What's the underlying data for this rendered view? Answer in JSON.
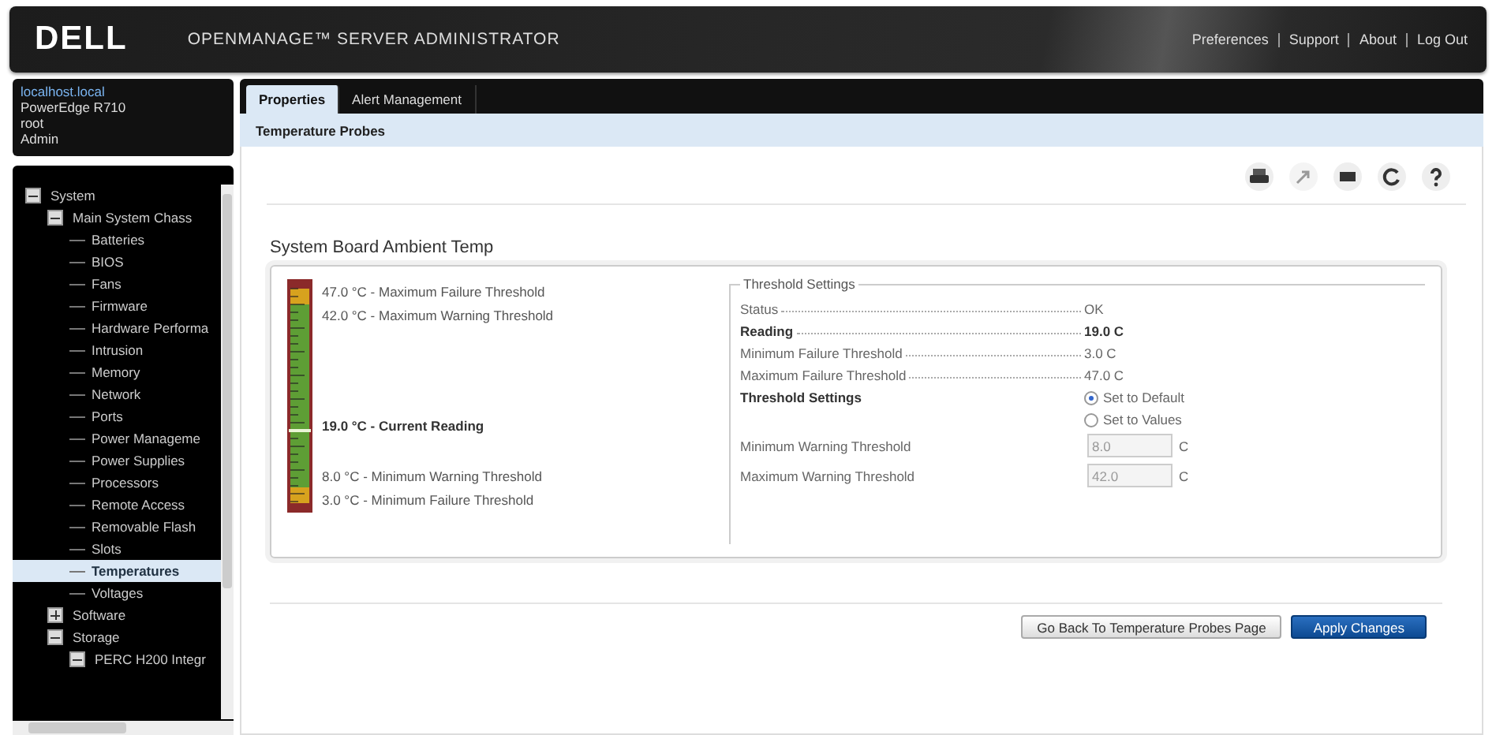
{
  "header": {
    "logo": "DELL",
    "product": "OPENMANAGE™ SERVER ADMINISTRATOR",
    "links": [
      "Preferences",
      "Support",
      "About",
      "Log Out"
    ]
  },
  "host": {
    "name": "localhost.local",
    "model": "PowerEdge R710",
    "user": "root",
    "role": "Admin"
  },
  "tree": [
    {
      "label": "System",
      "selected": false,
      "expanded": true,
      "children": [
        {
          "label": "Main System Chass",
          "selected": false,
          "expanded": true,
          "children": [
            {
              "label": "Batteries",
              "selected": false
            },
            {
              "label": "BIOS",
              "selected": false
            },
            {
              "label": "Fans",
              "selected": false
            },
            {
              "label": "Firmware",
              "selected": false
            },
            {
              "label": "Hardware Performa",
              "selected": false
            },
            {
              "label": "Intrusion",
              "selected": false
            },
            {
              "label": "Memory",
              "selected": false
            },
            {
              "label": "Network",
              "selected": false
            },
            {
              "label": "Ports",
              "selected": false
            },
            {
              "label": "Power Manageme",
              "selected": false
            },
            {
              "label": "Power Supplies",
              "selected": false
            },
            {
              "label": "Processors",
              "selected": false
            },
            {
              "label": "Remote Access",
              "selected": false
            },
            {
              "label": "Removable Flash",
              "selected": false
            },
            {
              "label": "Slots",
              "selected": false
            },
            {
              "label": "Temperatures",
              "selected": true
            },
            {
              "label": "Voltages",
              "selected": false
            }
          ]
        },
        {
          "label": "Software",
          "selected": false,
          "expanded": false
        },
        {
          "label": "Storage",
          "selected": false,
          "expanded": true,
          "children": [
            {
              "label": "PERC H200 Integr",
              "selected": false,
              "expanded": true
            }
          ]
        }
      ]
    }
  ],
  "tabs": [
    {
      "label": "Properties",
      "selected": true
    },
    {
      "label": "Alert Management",
      "selected": false
    }
  ],
  "section_title": "Temperature Probes",
  "probe": {
    "title": "System Board Ambient Temp",
    "upper_labels": [
      "47.0 °C - Maximum Failure Threshold",
      "42.0 °C - Maximum Warning Threshold"
    ],
    "current_label": "19.0 °C - Current Reading",
    "lower_labels": [
      "8.0 °C - Minimum Warning Threshold",
      "3.0 °C - Minimum Failure Threshold"
    ]
  },
  "threshold": {
    "legend": "Threshold Settings",
    "rows": [
      {
        "label": "Status",
        "value": "OK",
        "bold": false
      },
      {
        "label": "Reading",
        "value": "19.0 C",
        "bold": true
      },
      {
        "label": "Minimum Failure Threshold",
        "value": "3.0 C",
        "bold": false
      },
      {
        "label": "Maximum Failure Threshold",
        "value": "47.0 C",
        "bold": false
      }
    ],
    "settings_label": "Threshold Settings",
    "radios": [
      {
        "label": "Set to Default",
        "selected": true
      },
      {
        "label": "Set to Values",
        "selected": false
      }
    ],
    "inputs": [
      {
        "label": "Minimum Warning Threshold",
        "value": "8.0",
        "unit": "C",
        "disabled": true
      },
      {
        "label": "Maximum Warning Threshold",
        "value": "42.0",
        "unit": "C",
        "disabled": true
      }
    ]
  },
  "buttons": [
    {
      "label": "Go Back To Temperature Probes Page",
      "kind": "secondary"
    },
    {
      "label": "Apply Changes",
      "kind": "primary"
    }
  ]
}
